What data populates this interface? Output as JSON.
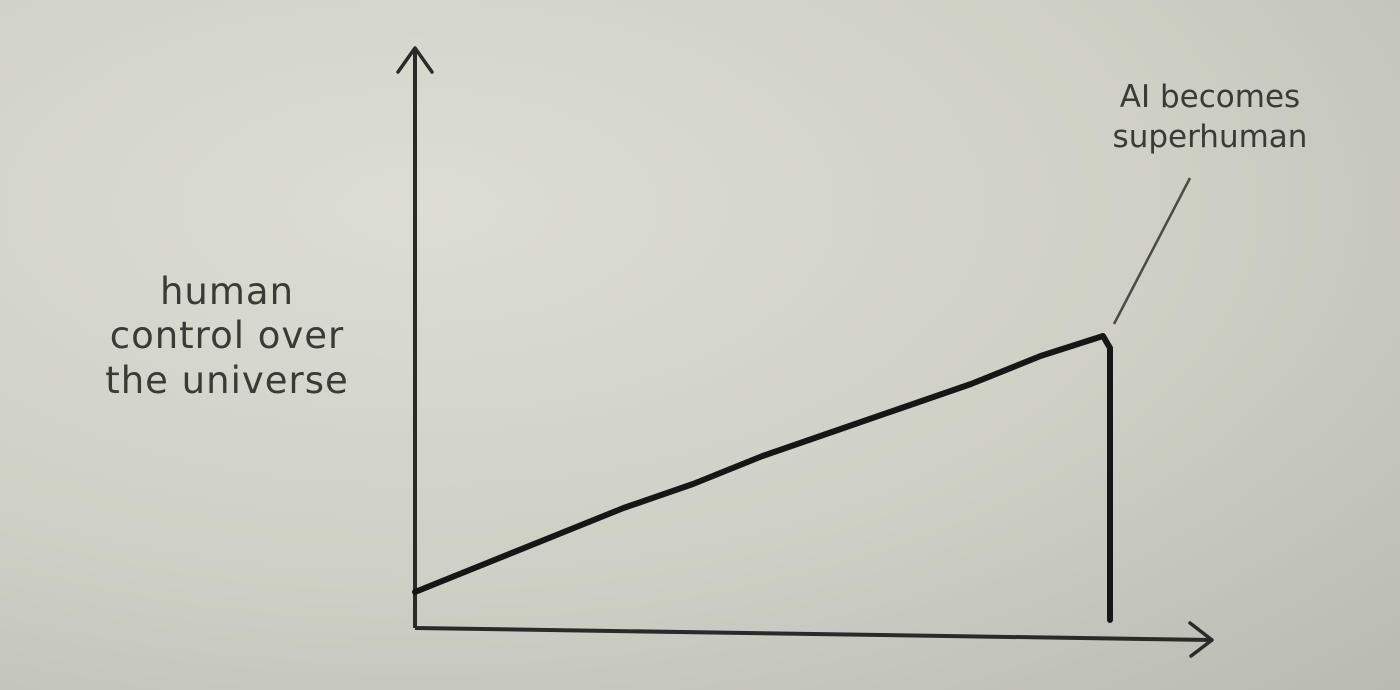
{
  "chart_data": {
    "type": "line",
    "title": "",
    "xlabel": "",
    "ylabel_lines": [
      "human",
      "control over",
      "the universe"
    ],
    "xlim": [
      0,
      100
    ],
    "ylim": [
      0,
      100
    ],
    "grid": false,
    "series": [
      {
        "x": [
          0,
          10,
          20,
          30,
          40,
          50,
          60,
          70,
          80,
          90,
          99,
          100,
          100
        ],
        "y": [
          9,
          16,
          23,
          30,
          36,
          43,
          49,
          55,
          61,
          68,
          73,
          70,
          2
        ]
      }
    ],
    "annotations": [
      {
        "text_lines": [
          "AI becomes",
          "superhuman"
        ],
        "x": 100,
        "y": 74
      }
    ],
    "colors": {
      "line": "#161616",
      "axis": "#2a2a2a",
      "text": "#3a3a38"
    }
  }
}
